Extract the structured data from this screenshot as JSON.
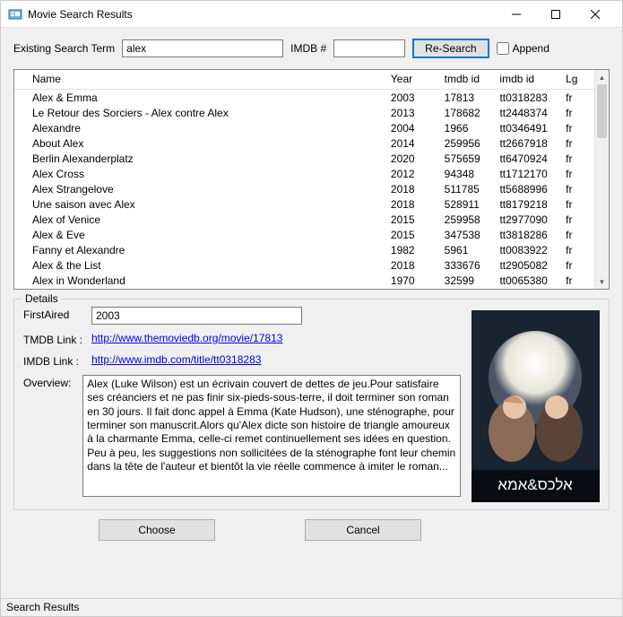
{
  "titlebar": {
    "title": "Movie Search Results"
  },
  "searchRow": {
    "existing_label": "Existing Search Term",
    "search_value": "alex",
    "imdb_label": "IMDB #",
    "imdb_value": "",
    "research_label": "Re-Search",
    "append_label": "Append"
  },
  "grid": {
    "headers": {
      "name": "Name",
      "year": "Year",
      "tmdb": "tmdb id",
      "imdb": "imdb id",
      "lg": "Lg"
    },
    "rows": [
      {
        "name": "Alex & Emma",
        "year": "2003",
        "tmdb": "17813",
        "imdb": "tt0318283",
        "lg": "fr"
      },
      {
        "name": "Le Retour des Sorciers - Alex contre Alex",
        "year": "2013",
        "tmdb": "178682",
        "imdb": "tt2448374",
        "lg": "fr"
      },
      {
        "name": "Alexandre",
        "year": "2004",
        "tmdb": "1966",
        "imdb": "tt0346491",
        "lg": "fr"
      },
      {
        "name": "About Alex",
        "year": "2014",
        "tmdb": "259956",
        "imdb": "tt2667918",
        "lg": "fr"
      },
      {
        "name": "Berlin Alexanderplatz",
        "year": "2020",
        "tmdb": "575659",
        "imdb": "tt6470924",
        "lg": "fr"
      },
      {
        "name": "Alex Cross",
        "year": "2012",
        "tmdb": "94348",
        "imdb": "tt1712170",
        "lg": "fr"
      },
      {
        "name": "Alex Strangelove",
        "year": "2018",
        "tmdb": "511785",
        "imdb": "tt5688996",
        "lg": "fr"
      },
      {
        "name": "Une saison avec Alex",
        "year": "2018",
        "tmdb": "528911",
        "imdb": "tt8179218",
        "lg": "fr"
      },
      {
        "name": "Alex of Venice",
        "year": "2015",
        "tmdb": "259958",
        "imdb": "tt2977090",
        "lg": "fr"
      },
      {
        "name": "Alex & Eve",
        "year": "2015",
        "tmdb": "347538",
        "imdb": "tt3818286",
        "lg": "fr"
      },
      {
        "name": "Fanny et Alexandre",
        "year": "1982",
        "tmdb": "5961",
        "imdb": "tt0083922",
        "lg": "fr"
      },
      {
        "name": "Alex & the List",
        "year": "2018",
        "tmdb": "333676",
        "imdb": "tt2905082",
        "lg": "fr"
      },
      {
        "name": "Alex in Wonderland",
        "year": "1970",
        "tmdb": "32599",
        "imdb": "tt0065380",
        "lg": "fr"
      }
    ]
  },
  "details": {
    "legend": "Details",
    "firstaired_label": "FirstAired",
    "firstaired_value": "2003",
    "tmdblink_label": "TMDB Link  :",
    "tmdblink_value": "http://www.themoviedb.org/movie/17813",
    "imdblink_label": "IMDB Link  :",
    "imdblink_value": "http://www.imdb.com/title/tt0318283",
    "overview_label": "Overview:",
    "overview_value": "Alex (Luke Wilson) est un écrivain couvert de dettes de jeu.Pour satisfaire ses créanciers et ne pas finir six-pieds-sous-terre, il doit terminer son roman en 30 jours. Il fait donc appel à Emma (Kate Hudson), une sténographe, pour terminer son manuscrit.Alors qu'Alex dicte son histoire de triangle amoureux à la charmante Emma, celle-ci remet continuellement ses idées en question. Peu à peu, les suggestions non sollicitées de la sténographe font leur chemin dans la tête de l'auteur et bientôt la vie réelle commence à imiter le roman...",
    "poster_text": "אלכס&אמא"
  },
  "buttons": {
    "choose": "Choose",
    "cancel": "Cancel"
  },
  "statusbar": "Search Results"
}
